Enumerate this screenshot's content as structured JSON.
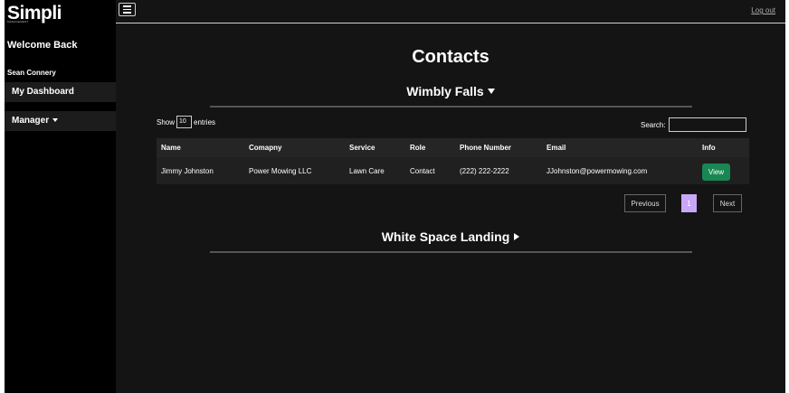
{
  "brand": {
    "name": "Simpli",
    "tagline": "MANAGEMENT"
  },
  "sidebar": {
    "welcome": "Welcome Back",
    "user": "Sean Connery",
    "items": [
      {
        "label": "My Dashboard"
      },
      {
        "label": "Manager"
      }
    ]
  },
  "topbar": {
    "logout": "Log out"
  },
  "page": {
    "title": "Contacts"
  },
  "sections": [
    {
      "title": "Wimbly Falls",
      "expanded": true
    },
    {
      "title": "White Space Landing",
      "expanded": false
    }
  ],
  "table": {
    "show_label": "Show",
    "entries_value": "10",
    "entries_label": "entries",
    "search_label": "Search:",
    "search_value": "",
    "columns": [
      "Name",
      "Comapny",
      "Service",
      "Role",
      "Phone Number",
      "Email",
      "Info"
    ],
    "rows": [
      [
        "Jimmy Johnston",
        "Power Mowing LLC",
        "Lawn Care",
        "Contact",
        "(222) 222-2222",
        "JJohnston@powermowing.com",
        "View"
      ]
    ]
  },
  "pagination": {
    "previous": "Previous",
    "current": "1",
    "next": "Next"
  },
  "colors": {
    "accent_green": "#198754",
    "page_active": "#c9a7f7",
    "background": "#141414",
    "sidebar": "#000000"
  }
}
